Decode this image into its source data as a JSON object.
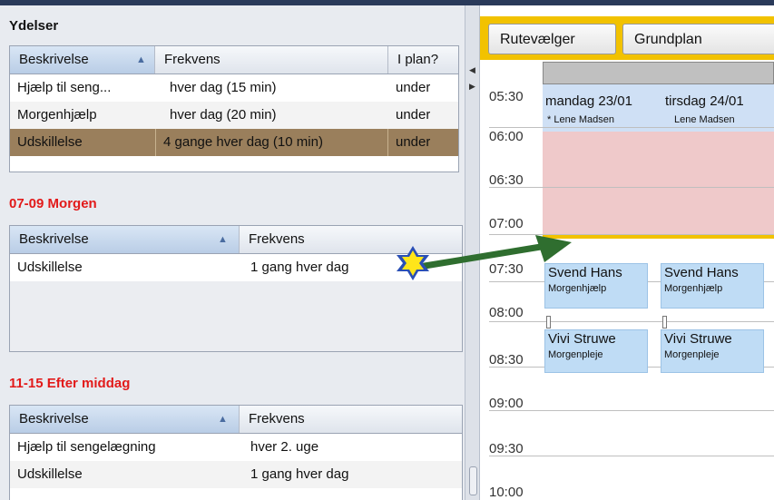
{
  "ydelser": {
    "title": "Ydelser",
    "columns": [
      "Beskrivelse",
      "Frekvens",
      "I plan?"
    ],
    "rows": [
      {
        "beskrivelse": "Hjælp til seng...",
        "frekvens": "hver dag (15 min)",
        "iplan": "under"
      },
      {
        "beskrivelse": "Morgenhjælp",
        "frekvens": "hver dag (20 min)",
        "iplan": "under"
      },
      {
        "beskrivelse": "Udskillelse",
        "frekvens": "4 gange hver dag (10 min)",
        "iplan": "under"
      }
    ]
  },
  "morgen": {
    "title": "07-09 Morgen",
    "columns": [
      "Beskrivelse",
      "Frekvens"
    ],
    "rows": [
      {
        "beskrivelse": "Udskillelse",
        "frekvens": "1 gang hver dag"
      }
    ]
  },
  "eftermiddag": {
    "title": "11-15 Efter middag",
    "columns": [
      "Beskrivelse",
      "Frekvens"
    ],
    "rows": [
      {
        "beskrivelse": "Hjælp til sengelægning",
        "frekvens": "hver 2. uge"
      },
      {
        "beskrivelse": "Udskillelse",
        "frekvens": "1 gang hver dag"
      }
    ]
  },
  "toolbar": {
    "rutevaelger": "Rutevælger",
    "grundplan": "Grundplan"
  },
  "times": [
    "05:30",
    "06:00",
    "06:30",
    "07:00",
    "07:30",
    "08:00",
    "08:30",
    "09:00",
    "09:30",
    "10:00"
  ],
  "days": [
    {
      "label": "mandag 23/01",
      "person": "* Lene Madsen"
    },
    {
      "label": "tirsdag 24/01",
      "person": "Lene Madsen"
    }
  ],
  "appointments": {
    "a1": {
      "name": "Svend Hans",
      "service": "Morgenhjælp"
    },
    "a2": {
      "name": "Svend Hans",
      "service": "Morgenhjælp"
    },
    "a3": {
      "name": "Vivi Struwe",
      "service": "Morgenpleje"
    },
    "a4": {
      "name": "Vivi Struwe",
      "service": "Morgenpleje"
    }
  },
  "colors": {
    "selected_row": "#9a7f5c",
    "section_title": "#e21a1a",
    "toolbar": "#f2c200",
    "blocked": "#efc9ca",
    "appointment": "#bfdcf5"
  }
}
